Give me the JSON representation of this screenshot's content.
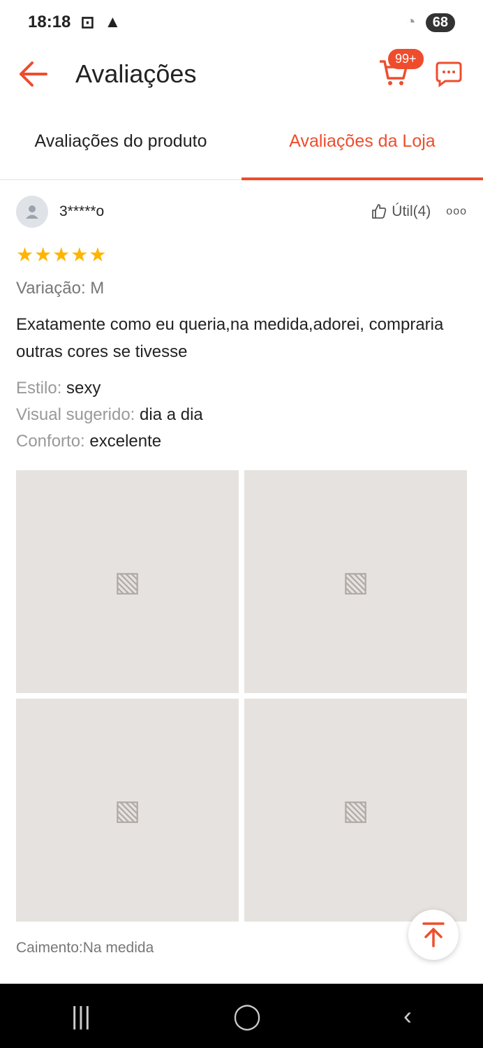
{
  "status": {
    "time": "18:18",
    "battery": "68"
  },
  "header": {
    "title": "Avaliações",
    "cart_badge": "99+"
  },
  "tabs": [
    {
      "label": "Avaliações do produto"
    },
    {
      "label": "Avaliações da Loja"
    }
  ],
  "review": {
    "username": "3*****o",
    "useful": "Útil(4)",
    "stars": "★★★★★",
    "variation": "Variação: M",
    "comment": "Exatamente como eu queria,na medida,adorei, compraria outras cores se tivesse",
    "attributes": [
      {
        "key": "Estilo:",
        "value": "sexy"
      },
      {
        "key": "Visual sugerido:",
        "value": "dia a dia"
      },
      {
        "key": "Conforto:",
        "value": "excelente"
      }
    ],
    "fit": "Caimento:Na medida"
  },
  "colors": {
    "accent": "#ee4d2d",
    "star": "#ffb400"
  }
}
